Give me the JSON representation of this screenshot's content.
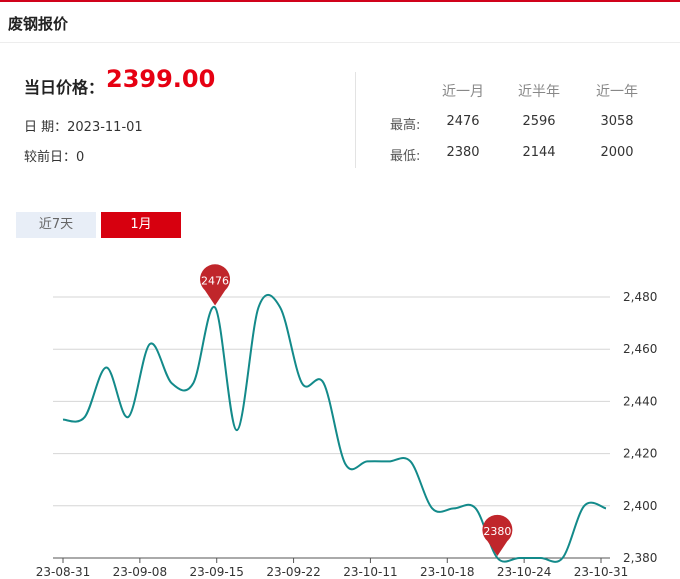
{
  "header": {
    "title": "废钢报价"
  },
  "today": {
    "price_label": "当日价格：",
    "price_value": "2399.00",
    "date_label": "日 期：",
    "date_value": "2023-11-01",
    "change_label": "较前日：",
    "change_value": "0"
  },
  "stats": {
    "columns": [
      "近一月",
      "近半年",
      "近一年"
    ],
    "rows": [
      {
        "label": "最高:",
        "values": [
          "2476",
          "2596",
          "3058"
        ]
      },
      {
        "label": "最低:",
        "values": [
          "2380",
          "2144",
          "2000"
        ]
      }
    ]
  },
  "tabs": [
    {
      "label": "近7天",
      "active": false
    },
    {
      "label": "1月",
      "active": true
    }
  ],
  "colors": {
    "accent": "#d7000f",
    "line": "#138a8a",
    "marker": "#c0262b"
  },
  "chart_data": {
    "type": "line",
    "x_ticks": [
      "23-08-31",
      "23-09-08",
      "23-09-15",
      "23-09-22",
      "23-10-11",
      "23-10-18",
      "23-10-24",
      "23-10-31"
    ],
    "y_ticks": [
      "2,380",
      "2,400",
      "2,420",
      "2,440",
      "2,460",
      "2,480"
    ],
    "ylim": [
      2380,
      2480
    ],
    "grid": true,
    "series": [
      {
        "values": [
          2433,
          2434,
          2453,
          2434,
          2462,
          2447,
          2447,
          2476,
          2429,
          2476,
          2476,
          2447,
          2447,
          2416,
          2417,
          2417,
          2417,
          2399,
          2399,
          2399,
          2380,
          2380,
          2380,
          2380,
          2400,
          2399
        ]
      }
    ],
    "markers": [
      {
        "label": "2476",
        "index": 7
      },
      {
        "label": "2380",
        "index": 20
      }
    ]
  }
}
